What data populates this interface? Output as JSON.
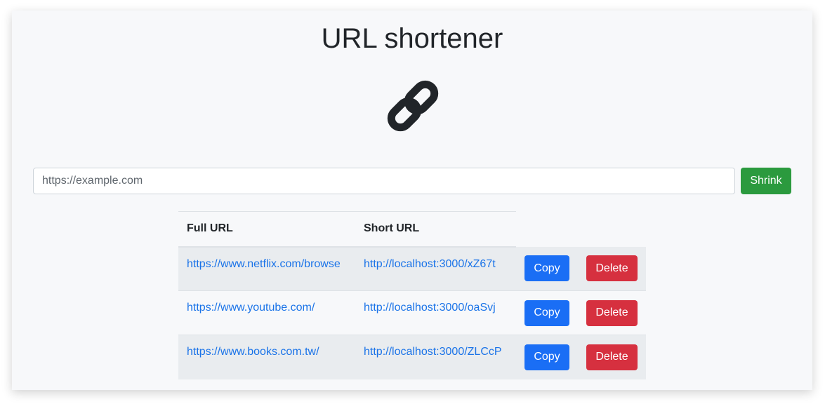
{
  "title": "URL shortener",
  "logo_icon": "link-icon",
  "input": {
    "placeholder": "https://example.com",
    "value": ""
  },
  "shrink_label": "Shrink",
  "table": {
    "headers": {
      "full": "Full URL",
      "short": "Short URL"
    },
    "rows": [
      {
        "full": "https://www.netflix.com/browse",
        "short": "http://localhost:3000/xZ67t",
        "copy": "Copy",
        "delete": "Delete"
      },
      {
        "full": "https://www.youtube.com/",
        "short": "http://localhost:3000/oaSvj",
        "copy": "Copy",
        "delete": "Delete"
      },
      {
        "full": "https://www.books.com.tw/",
        "short": "http://localhost:3000/ZLCcP",
        "copy": "Copy",
        "delete": "Delete"
      }
    ]
  },
  "colors": {
    "shrink": "#2b9a3e",
    "copy": "#1a6ef5",
    "delete": "#d6303f",
    "link": "#1a73e8"
  }
}
